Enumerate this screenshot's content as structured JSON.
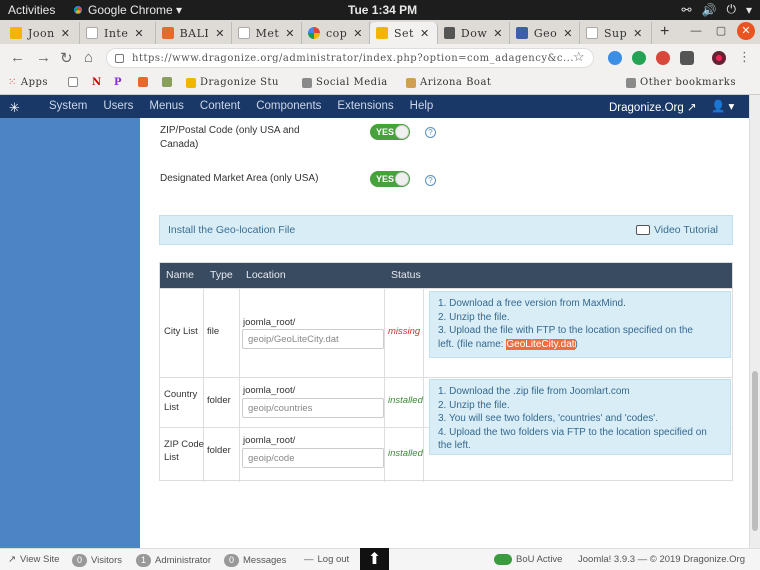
{
  "os_bar": {
    "activities": "Activities",
    "app_name": "Google Chrome ▾",
    "clock": "Tue  1:34 PM"
  },
  "tabs": [
    {
      "label": "Joon",
      "active": false
    },
    {
      "label": "Inte",
      "active": false
    },
    {
      "label": "BALI",
      "active": false
    },
    {
      "label": "Met",
      "active": false
    },
    {
      "label": "cop",
      "active": false
    },
    {
      "label": "Set",
      "active": true
    },
    {
      "label": "Dow",
      "active": false
    },
    {
      "label": "Geo",
      "active": false
    },
    {
      "label": "Sup",
      "active": false
    }
  ],
  "address_bar": {
    "url": "https://www.dragonize.org/administrator/index.php?option=com_adagency&c..."
  },
  "bookmarks": {
    "apps": "Apps",
    "dragonize": "Dragonize Stu",
    "social": "Social Media",
    "arizona": "Arizona Boat",
    "other": "Other bookmarks"
  },
  "joomla_nav": {
    "items": [
      "System",
      "Users",
      "Menus",
      "Content",
      "Components",
      "Extensions",
      "Help"
    ],
    "site_name": "Dragonize.Org",
    "user_caret": "▾"
  },
  "settings": {
    "zip_label": "ZIP/Postal Code (only USA and Canada)",
    "zip_toggle": "YES",
    "dma_label": "Designated Market Area (only USA)",
    "dma_toggle": "YES",
    "help_glyph": "?"
  },
  "geo_banner": {
    "title": "Install the Geo-location File",
    "video_link": "Video Tutorial"
  },
  "geo_table": {
    "headers": [
      "Name",
      "Type",
      "Location",
      "Status"
    ],
    "rows": [
      {
        "name_1": "City List",
        "name_2": "",
        "type": "file",
        "root": "joomla_root/",
        "path": "geoip/GeoLiteCity.dat",
        "status": "missing"
      },
      {
        "name_1": "Country",
        "name_2": "List",
        "type": "folder",
        "root": "joomla_root/",
        "path": "geoip/countries",
        "status": "installed"
      },
      {
        "name_1": "ZIP Code",
        "name_2": "List",
        "type": "folder",
        "root": "joomla_root/",
        "path": "geoip/code",
        "status": "installed"
      }
    ],
    "instructions_city": {
      "l1": "1. Download a free version from MaxMind.",
      "l2": "2. Unzip the file.",
      "l3": "3. Upload the file with FTP to the location specified on the",
      "l4a": "left. (file name: ",
      "l4hl": "GeoLiteCity.dat",
      "l4b": ")"
    },
    "instructions_folders": {
      "l1": "1. Download the .zip file from Joomlart.com",
      "l2": "2. Unzip the file.",
      "l3": "3. You will see two folders, 'countries' and 'codes'.",
      "l4": "4. Upload the two folders via FTP to the location specified on",
      "l5": "the left."
    }
  },
  "status_bar": {
    "view_site": "View Site",
    "visitors_count": "0",
    "visitors": "Visitors",
    "admin_count": "1",
    "administrator": "Administrator",
    "messages_count": "0",
    "messages": "Messages",
    "logout": "Log out",
    "bou": "BoU Active",
    "version": "Joomla! 3.9.3 — © 2019 Dragonize.Org"
  },
  "colors": {
    "joomla_nav": "#1a3867",
    "sidebar": "#4d84c6",
    "toggle_green": "#47a23c",
    "info_bg": "#d9edf7",
    "table_head": "#394b61",
    "highlight": "#e9703e"
  }
}
